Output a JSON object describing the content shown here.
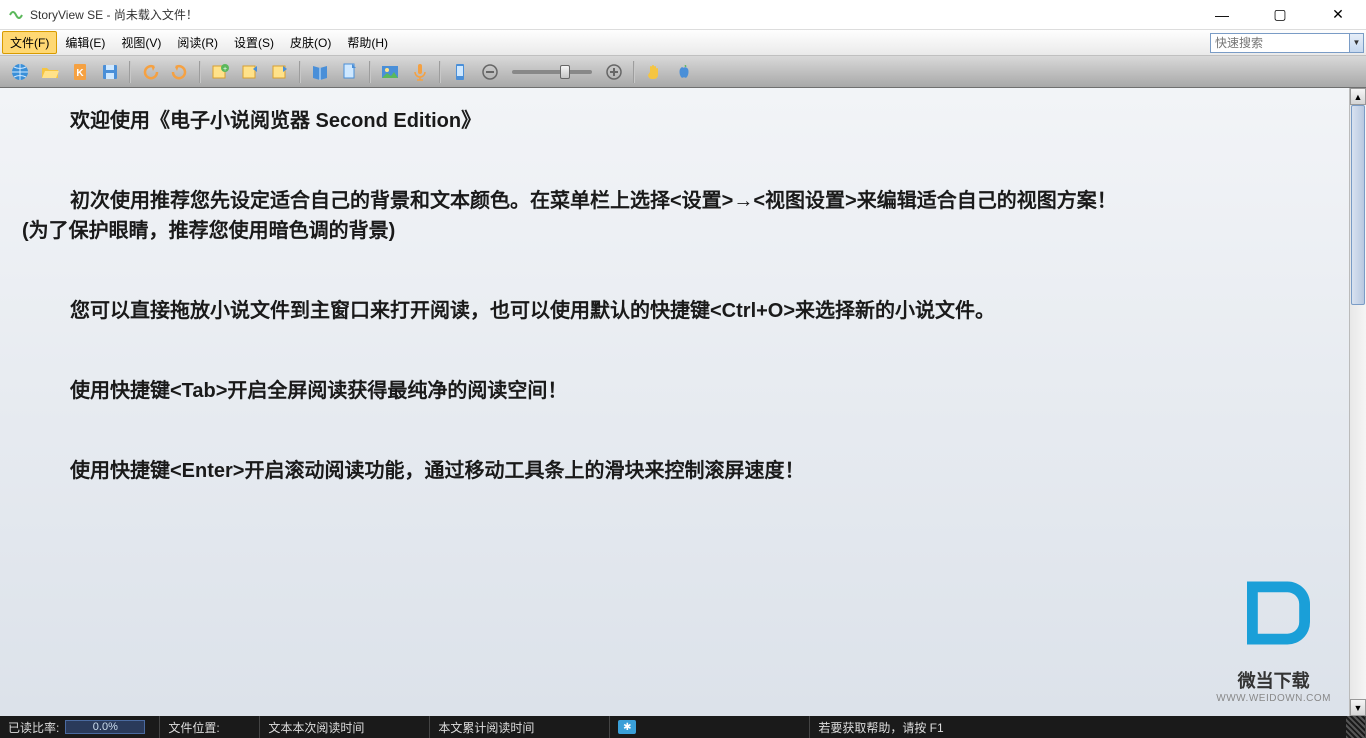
{
  "titlebar": {
    "app_name": "StoryView SE",
    "separator": " - ",
    "doc_status": "尚未载入文件！"
  },
  "menus": {
    "file": "文件(F)",
    "edit": "编辑(E)",
    "view": "视图(V)",
    "read": "阅读(R)",
    "settings": "设置(S)",
    "skin": "皮肤(O)",
    "help": "帮助(H)"
  },
  "search": {
    "placeholder": "快速搜索"
  },
  "toolbar_icons": [
    "globe-icon",
    "open-folder-icon",
    "clipboard-k-icon",
    "save-icon",
    "repeat-left-icon",
    "repeat-right-icon",
    "bookmark-add-icon",
    "bookmark-prev-icon",
    "bookmark-next-icon",
    "book-icon",
    "page-icon",
    "image-icon",
    "mic-icon",
    "phone-icon",
    "zoom-out-icon",
    "zoom-in-icon",
    "hand-icon",
    "apple-icon"
  ],
  "content": {
    "p1": "欢迎使用《电子小说阅览器 Second Edition》",
    "p2": "初次使用推荐您先设定适合自己的背景和文本颜色。在菜单栏上选择<设置>→<视图设置>来编辑适合自己的视图方案！",
    "p2b": "(为了保护眼睛，推荐您使用暗色调的背景)",
    "p3": "您可以直接拖放小说文件到主窗口来打开阅读，也可以使用默认的快捷键<Ctrl+O>来选择新的小说文件。",
    "p4": "使用快捷键<Tab>开启全屏阅读获得最纯净的阅读空间！",
    "p5": "使用快捷键<Enter>开启滚动阅读功能，通过移动工具条上的滑块来控制滚屏速度！"
  },
  "watermark": {
    "text": "微当下载",
    "url": "WWW.WEIDOWN.COM"
  },
  "statusbar": {
    "read_ratio_label": "已读比率:",
    "read_ratio_value": "0.0%",
    "file_pos_label": "文件位置:",
    "session_time_label": "文本本次阅读时间",
    "total_time_label": "本文累计阅读时间",
    "help_hint": "若要获取帮助，请按 F1"
  }
}
